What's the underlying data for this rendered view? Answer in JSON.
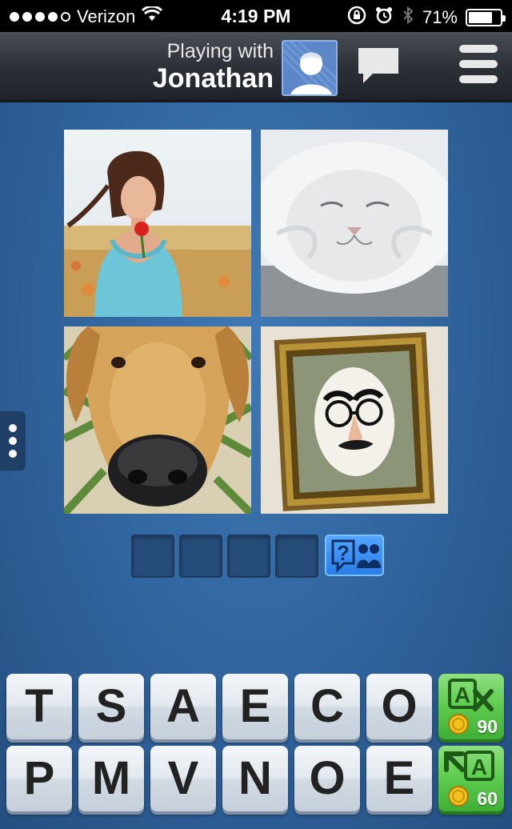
{
  "status_bar": {
    "carrier": "Verizon",
    "time": "4:19 PM",
    "battery": "71%",
    "battery_level": 0.71,
    "signal_bars": 4,
    "signal_icon": "signal-dots-icon",
    "wifi_icon": "wifi-icon",
    "lock_icon": "rotation-lock-icon",
    "alarm_icon": "alarm-icon",
    "bluetooth_icon": "bluetooth-icon",
    "battery_icon": "battery-icon"
  },
  "header": {
    "playing_label": "Playing with",
    "partner_name": "Jonathan",
    "avatar_icon": "person-avatar-icon",
    "chat_icon": "chat-bubble-icon",
    "menu_icon": "hamburger-menu-icon"
  },
  "puzzle": {
    "photos": [
      {
        "name": "woman-with-red-flower"
      },
      {
        "name": "white-cat-face"
      },
      {
        "name": "dog-nose-closeup"
      },
      {
        "name": "framed-disguise-glasses-nose"
      }
    ],
    "answer_length": 4,
    "answer_slots": [
      "",
      "",
      "",
      ""
    ],
    "ask_friends_icon": "question-friends-icon",
    "side_handle_icon": "vertical-dots-icon"
  },
  "letters": {
    "row1": [
      "T",
      "S",
      "A",
      "E",
      "C",
      "O"
    ],
    "row2": [
      "P",
      "M",
      "V",
      "N",
      "O",
      "E"
    ]
  },
  "powerups": {
    "remove_letters": {
      "icon": "remove-letter-icon",
      "cost": "90"
    },
    "reveal_letter": {
      "icon": "reveal-letter-icon",
      "cost": "60"
    },
    "coin_icon": "coin-icon"
  },
  "colors": {
    "background": "#2f629b",
    "nav_bar": "#2c3138",
    "powerup_green": "#5ccb4d",
    "ask_button_blue": "#2a7de6"
  }
}
